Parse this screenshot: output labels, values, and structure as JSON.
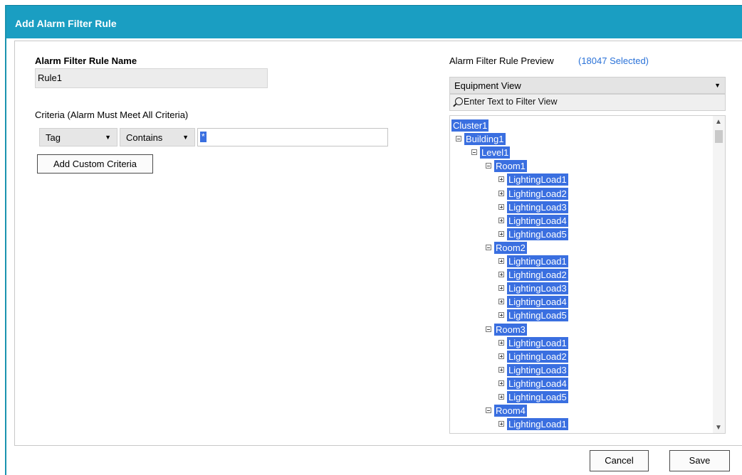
{
  "dialog": {
    "title": "Add Alarm Filter Rule"
  },
  "rule_name": {
    "label": "Alarm Filter Rule Name",
    "value": "Rule1"
  },
  "criteria": {
    "label": "Criteria (Alarm Must Meet All Criteria)",
    "field": "Tag",
    "operator": "Contains",
    "value": "*",
    "add_button": "Add Custom Criteria"
  },
  "preview": {
    "label": "Alarm Filter Rule Preview",
    "selected_count": "(18047 Selected)",
    "view": "Equipment View",
    "filter_placeholder": "Enter Text to Filter View",
    "tree": [
      {
        "label": "Cluster1",
        "level": 0,
        "toggle": "none"
      },
      {
        "label": "Building1",
        "level": 1,
        "toggle": "minus"
      },
      {
        "label": "Level1",
        "level": 2,
        "toggle": "minus"
      },
      {
        "label": "Room1",
        "level": 3,
        "toggle": "minus"
      },
      {
        "label": "LightingLoad1",
        "level": 4,
        "toggle": "plus"
      },
      {
        "label": "LightingLoad2",
        "level": 4,
        "toggle": "plus"
      },
      {
        "label": "LightingLoad3",
        "level": 4,
        "toggle": "plus"
      },
      {
        "label": "LightingLoad4",
        "level": 4,
        "toggle": "plus"
      },
      {
        "label": "LightingLoad5",
        "level": 4,
        "toggle": "plus"
      },
      {
        "label": "Room2",
        "level": 3,
        "toggle": "minus"
      },
      {
        "label": "LightingLoad1",
        "level": 4,
        "toggle": "plus"
      },
      {
        "label": "LightingLoad2",
        "level": 4,
        "toggle": "plus"
      },
      {
        "label": "LightingLoad3",
        "level": 4,
        "toggle": "plus"
      },
      {
        "label": "LightingLoad4",
        "level": 4,
        "toggle": "plus"
      },
      {
        "label": "LightingLoad5",
        "level": 4,
        "toggle": "plus"
      },
      {
        "label": "Room3",
        "level": 3,
        "toggle": "minus"
      },
      {
        "label": "LightingLoad1",
        "level": 4,
        "toggle": "plus"
      },
      {
        "label": "LightingLoad2",
        "level": 4,
        "toggle": "plus"
      },
      {
        "label": "LightingLoad3",
        "level": 4,
        "toggle": "plus"
      },
      {
        "label": "LightingLoad4",
        "level": 4,
        "toggle": "plus"
      },
      {
        "label": "LightingLoad5",
        "level": 4,
        "toggle": "plus"
      },
      {
        "label": "Room4",
        "level": 3,
        "toggle": "minus"
      },
      {
        "label": "LightingLoad1",
        "level": 4,
        "toggle": "plus"
      }
    ]
  },
  "buttons": {
    "cancel": "Cancel",
    "save": "Save"
  },
  "icons": {
    "dropdown": "chevron-down-icon",
    "search": "magnifier-icon",
    "scroll_up": "scroll-up-icon",
    "scroll_down": "scroll-down-icon"
  },
  "colors": {
    "title_bar": "#1a9ec2",
    "selection": "#3a6fe0",
    "link": "#2a72d8"
  }
}
